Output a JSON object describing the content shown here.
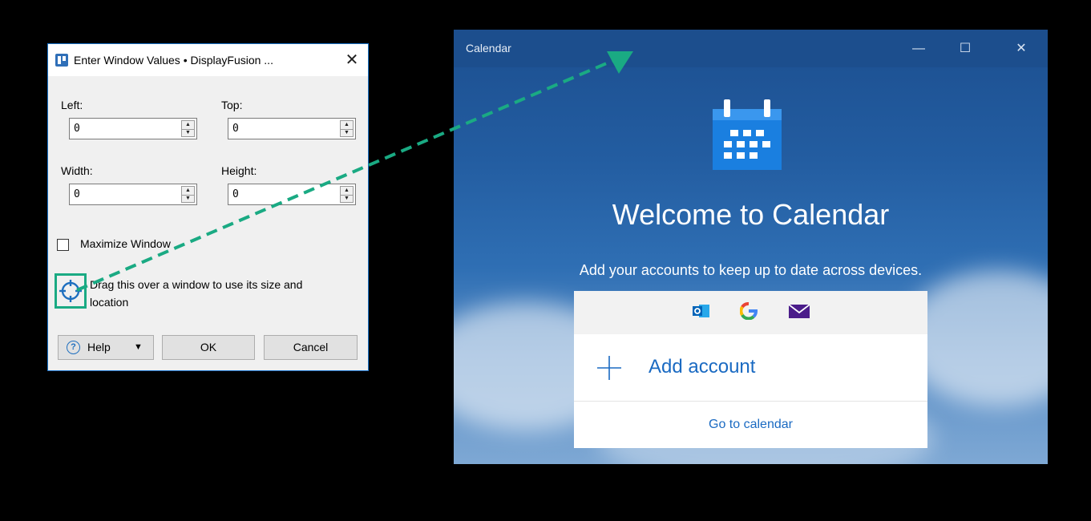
{
  "df_dialog": {
    "title": "Enter Window Values • DisplayFusion ...",
    "close_glyph": "✕",
    "left": {
      "label": "Left:",
      "value": "0"
    },
    "top": {
      "label": "Top:",
      "value": "0"
    },
    "width": {
      "label": "Width:",
      "value": "0"
    },
    "height": {
      "label": "Height:",
      "value": "0"
    },
    "maximize_label": "Maximize Window",
    "drag_text_line1": "Drag this over a window to use its size and",
    "drag_text_line2": "location",
    "help_icon": "?",
    "help_label": "Help",
    "help_arrow": "▼",
    "ok_label": "OK",
    "cancel_label": "Cancel"
  },
  "calendar": {
    "window_title": "Calendar",
    "minimize_glyph": "—",
    "maximize_glyph": "☐",
    "close_glyph": "✕",
    "welcome": "Welcome to Calendar",
    "subtitle": "Add your accounts to keep up to date across devices.",
    "add_account": "Add account",
    "go_to_calendar": "Go to calendar",
    "providers": [
      "outlook-icon",
      "google-icon",
      "mail-icon"
    ]
  },
  "colors": {
    "accent": "#1a6ac2",
    "arrow": "#1aaa83",
    "calendar_titlebar": "#1c4e8d",
    "dialog_border": "#1a73c9"
  }
}
